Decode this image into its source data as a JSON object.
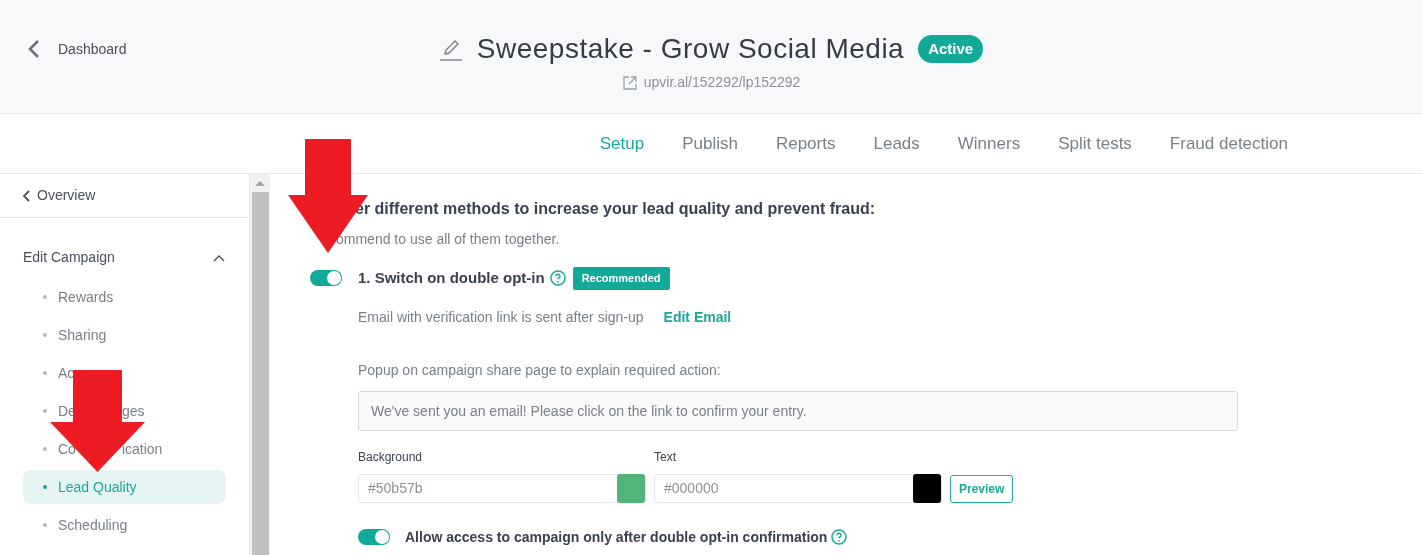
{
  "header": {
    "back_link": "Dashboard",
    "title": "Sweepstake - Grow Social Media",
    "status": "Active",
    "url": "upvir.al/152292/lp152292"
  },
  "tabs": [
    {
      "label": "Setup",
      "selected": true
    },
    {
      "label": "Publish",
      "selected": false
    },
    {
      "label": "Reports",
      "selected": false
    },
    {
      "label": "Leads",
      "selected": false
    },
    {
      "label": "Winners",
      "selected": false
    },
    {
      "label": "Split tests",
      "selected": false
    },
    {
      "label": "Fraud detection",
      "selected": false
    }
  ],
  "sidebar": {
    "back_link": "Overview",
    "section": {
      "title": "Edit Campaign",
      "expanded": true,
      "items": [
        {
          "label": "Rewards",
          "selected": false
        },
        {
          "label": "Sharing",
          "selected": false
        },
        {
          "label": "Ac",
          "selected": false
        },
        {
          "label": "De",
          "label_tail": "ges",
          "selected": false
        },
        {
          "label": "Co",
          "label_tail": "ication",
          "selected": false
        },
        {
          "label": "Lead Quality",
          "selected": true
        },
        {
          "label": "Scheduling",
          "selected": false
        }
      ]
    }
  },
  "content": {
    "heading": "er different methods to increase your lead quality and prevent fraud:",
    "note": "ommend to use all of them together.",
    "option": {
      "on": true,
      "label": "1. Switch on double opt-in",
      "badge": "Recommended",
      "description": "Email with verification link is sent after sign-up",
      "link": "Edit Email",
      "popup_label": "Popup on campaign share page to explain required action:",
      "popup_value": "We've sent you an email! Please click on the link to confirm your entry.",
      "colors": [
        {
          "label": "Background",
          "value": "#50b57b",
          "color": "#50b57b"
        },
        {
          "label": "Text",
          "value": "#000000",
          "color": "#000000"
        }
      ],
      "preview_button": "Preview",
      "access": {
        "on": true,
        "label": "Allow access to campaign only after double opt-in confirmation"
      }
    }
  },
  "annotations": [
    {
      "kind": "arrow"
    },
    {
      "kind": "arrow"
    }
  ]
}
